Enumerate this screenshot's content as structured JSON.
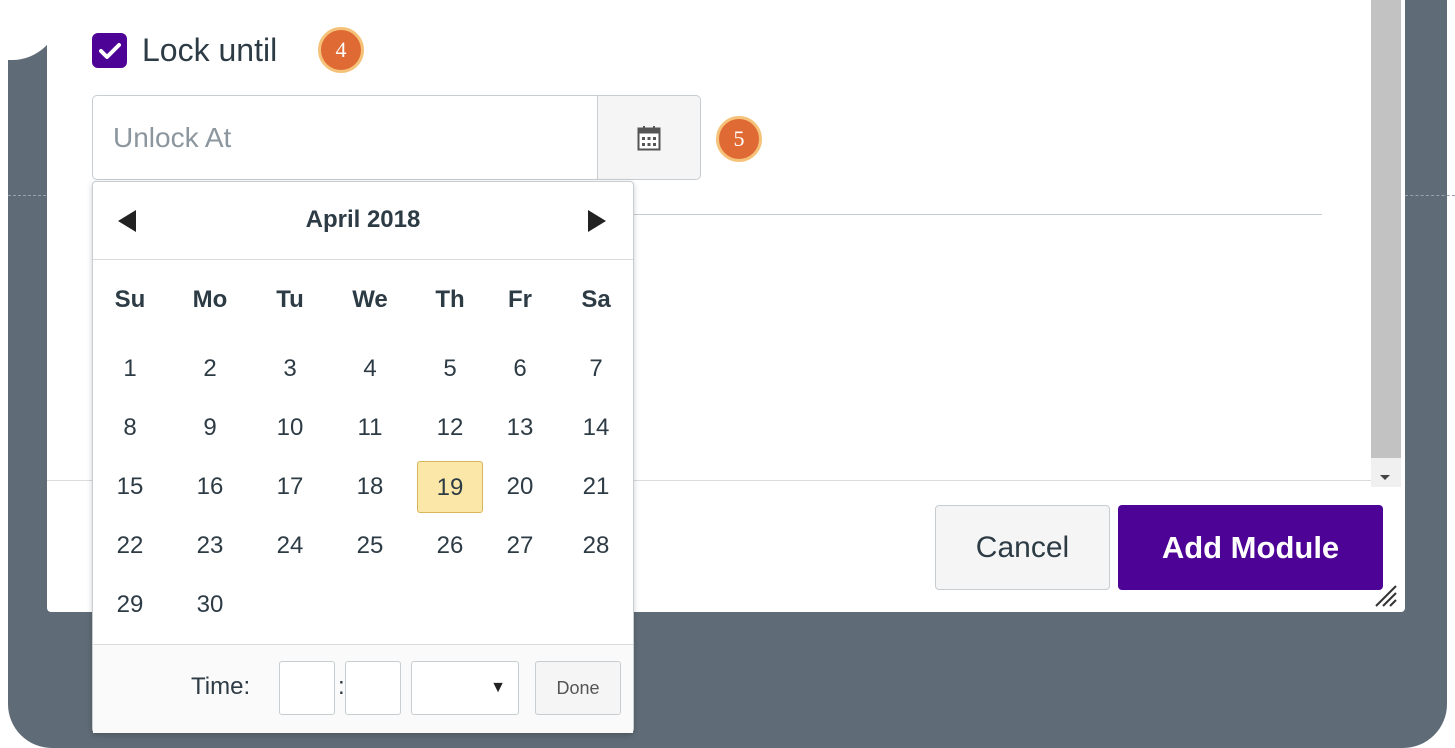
{
  "module_form": {
    "lock_until": {
      "label": "Lock until",
      "checked": true
    },
    "unlock_at": {
      "placeholder": "Unlock At",
      "value": ""
    },
    "icons": {
      "checkbox": "check-icon",
      "calendar": "calendar-icon"
    }
  },
  "callouts": {
    "step4": "4",
    "step5": "5"
  },
  "datepicker": {
    "month_year": "April 2018",
    "weekdays": [
      "Su",
      "Mo",
      "Tu",
      "We",
      "Th",
      "Fr",
      "Sa"
    ],
    "weeks": [
      [
        "1",
        "2",
        "3",
        "4",
        "5",
        "6",
        "7"
      ],
      [
        "8",
        "9",
        "10",
        "11",
        "12",
        "13",
        "14"
      ],
      [
        "15",
        "16",
        "17",
        "18",
        "19",
        "20",
        "21"
      ],
      [
        "22",
        "23",
        "24",
        "25",
        "26",
        "27",
        "28"
      ],
      [
        "29",
        "30"
      ]
    ],
    "today": "19",
    "time_label": "Time:",
    "time_colon": ":",
    "ampm_arrow": "▼",
    "done_label": "Done"
  },
  "footer": {
    "cancel_label": "Cancel",
    "add_label": "Add Module"
  },
  "colors": {
    "accent": "#4d0396",
    "backdrop": "#5f6b76",
    "callout": "#e06a33",
    "today_highlight": "#fbe7a8"
  }
}
